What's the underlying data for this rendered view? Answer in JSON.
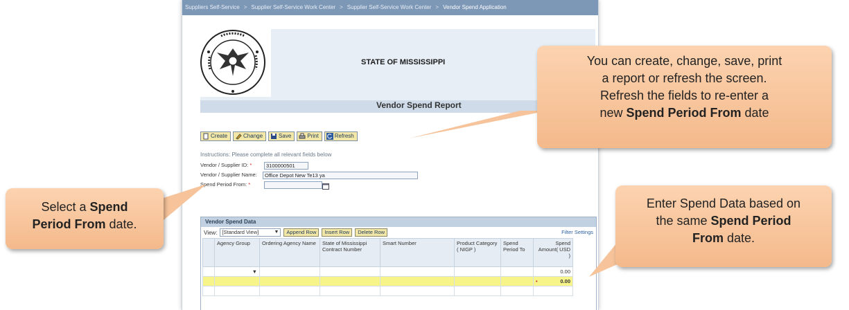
{
  "breadcrumb": [
    "Suppliers Self-Service",
    "Supplier Self-Service Work Center",
    "Supplier Self-Service Work Center",
    "Vendor Spend Application"
  ],
  "header": {
    "state": "STATE OF MISSISSIPPI",
    "report": "Vendor Spend Report"
  },
  "toolbar": {
    "create": "Create",
    "change": "Change",
    "save": "Save",
    "print": "Print",
    "refresh": "Refresh"
  },
  "form": {
    "instructions": "Instructions: Please complete all relevant fields below",
    "vendor_id_label": "Vendor / Supplier ID:",
    "vendor_id_value": "3100000501",
    "vendor_name_label": "Vendor / Supplier Name:",
    "vendor_name_value": "Office Depot New Te13 ya",
    "period_label": "Spend Period From:",
    "required_mark": "*"
  },
  "panel": {
    "title": "Vendor Spend Data",
    "view_label": "View:",
    "view_value": "[Standard View]",
    "append": "Append Row",
    "insert": "Insert Row",
    "delete": "Delete Row",
    "filter": "Filter Settings",
    "columns": [
      "Agency Group",
      "Ordering Agency Name",
      "State of Mississippi Contract Number",
      "Smart Number",
      "Product Category ( NIGP )",
      "Spend Period To",
      "Spend Amount( USD )"
    ],
    "row1_amount": "0.00",
    "row2_amount": "0.00",
    "row2_mark": "•"
  },
  "callouts": {
    "c1_l1": "You can create, change, save, print",
    "c1_l2": "a report or refresh the screen.",
    "c1_l3": "Refresh the fields to re-enter a",
    "c1_l4_pre": "new ",
    "c1_l4_bold": "Spend Period From",
    "c1_l4_post": " date",
    "c2_l1_pre": "Select a ",
    "c2_l1_bold": "Spend",
    "c2_l2_bold": "Period From",
    "c2_l2_post": " date.",
    "c3_l1": "Enter Spend Data based on",
    "c3_l2_pre": "the same ",
    "c3_l2_bold": "Spend Period",
    "c3_l3_bold": "From",
    "c3_l3_post": " date."
  },
  "colors": {
    "callout": "#f6c39a",
    "toolbar_button": "#f2e7a6",
    "breadcrumb_bar": "#7d97b6",
    "highlight_row": "#f7f58a"
  }
}
